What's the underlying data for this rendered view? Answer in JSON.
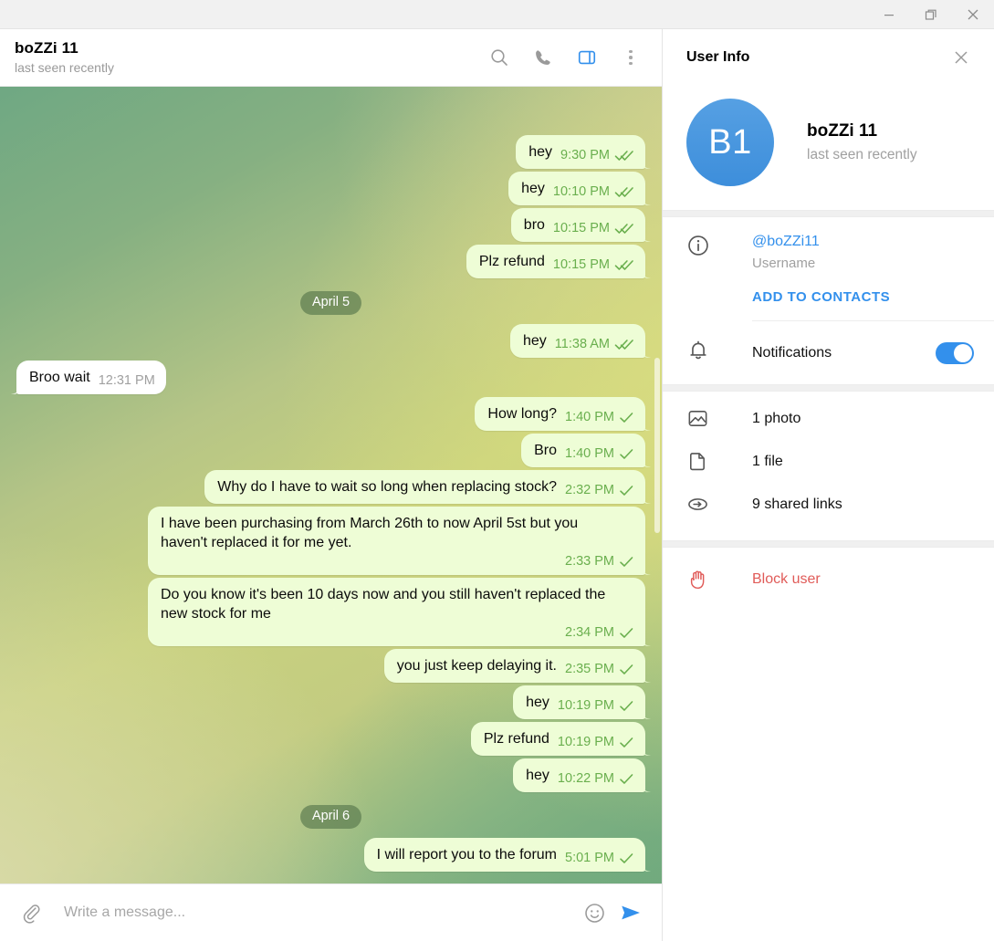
{
  "window": {
    "minimize_label": "Minimize",
    "restore_label": "Restore",
    "close_label": "Close"
  },
  "chat_header": {
    "title": "boZZi 11",
    "status": "last seen recently",
    "actions": [
      "search-icon",
      "phone-icon",
      "info-panel-toggle-icon",
      "more-menu-icon"
    ]
  },
  "conversation": {
    "items": [
      {
        "kind": "message",
        "dir": "out",
        "text": "hey",
        "time": "9:30 PM",
        "ticks": "double"
      },
      {
        "kind": "message",
        "dir": "out",
        "text": "hey",
        "time": "10:10 PM",
        "ticks": "double"
      },
      {
        "kind": "message",
        "dir": "out",
        "text": "bro",
        "time": "10:15 PM",
        "ticks": "double"
      },
      {
        "kind": "message",
        "dir": "out",
        "text": "Plz refund",
        "time": "10:15 PM",
        "ticks": "double"
      },
      {
        "kind": "date",
        "label": "April 5"
      },
      {
        "kind": "message",
        "dir": "out",
        "text": "hey",
        "time": "11:38 AM",
        "ticks": "double"
      },
      {
        "kind": "message",
        "dir": "in",
        "text": "Broo wait",
        "time": "12:31 PM",
        "ticks": "none"
      },
      {
        "kind": "message",
        "dir": "out",
        "text": "How long?",
        "time": "1:40 PM",
        "ticks": "single"
      },
      {
        "kind": "message",
        "dir": "out",
        "text": "Bro",
        "time": "1:40 PM",
        "ticks": "single"
      },
      {
        "kind": "message",
        "dir": "out",
        "text": "Why do I have to wait so long when replacing stock?",
        "time": "2:32 PM",
        "ticks": "single"
      },
      {
        "kind": "message",
        "dir": "out",
        "text": "I have been purchasing from March 26th to now April 5st but you haven't replaced it for me yet.",
        "time": "2:33 PM",
        "ticks": "single"
      },
      {
        "kind": "message",
        "dir": "out",
        "text": "Do you know it's been 10 days now and you still haven't replaced the new stock for me",
        "time": "2:34 PM",
        "ticks": "single"
      },
      {
        "kind": "message",
        "dir": "out",
        "text": "you just keep delaying it.",
        "time": "2:35 PM",
        "ticks": "single"
      },
      {
        "kind": "message",
        "dir": "out",
        "text": "hey",
        "time": "10:19 PM",
        "ticks": "single"
      },
      {
        "kind": "message",
        "dir": "out",
        "text": "Plz refund",
        "time": "10:19 PM",
        "ticks": "single"
      },
      {
        "kind": "message",
        "dir": "out",
        "text": "hey",
        "time": "10:22 PM",
        "ticks": "single"
      },
      {
        "kind": "date",
        "label": "April 6"
      },
      {
        "kind": "message",
        "dir": "out",
        "text": "I will report you to the forum",
        "time": "5:01 PM",
        "ticks": "single"
      }
    ]
  },
  "composer": {
    "attach_icon": "paperclip-icon",
    "placeholder": "Write a message...",
    "value": "",
    "emoji_icon": "emoji-icon",
    "send_icon": "send-icon"
  },
  "info_panel": {
    "title": "User Info",
    "close_icon": "close-icon",
    "avatar_initials": "B1",
    "name": "boZZi 11",
    "status": "last seen recently",
    "username_value": "@boZZi11",
    "username_label": "Username",
    "add_to_contacts": "ADD TO CONTACTS",
    "notifications_label": "Notifications",
    "notifications_on": true,
    "media": [
      {
        "icon": "photo-icon",
        "label": "1 photo"
      },
      {
        "icon": "file-icon",
        "label": "1 file"
      },
      {
        "icon": "link-icon",
        "label": "9 shared links"
      }
    ],
    "block_label": "Block user",
    "block_icon": "block-hand-icon"
  },
  "colors": {
    "accent": "#3390ec",
    "out_bubble": "#eefdd6",
    "in_bubble": "#ffffff",
    "tick_green": "#6aaf4e",
    "danger": "#e05b58",
    "avatar_blue": "#3d8edb"
  }
}
